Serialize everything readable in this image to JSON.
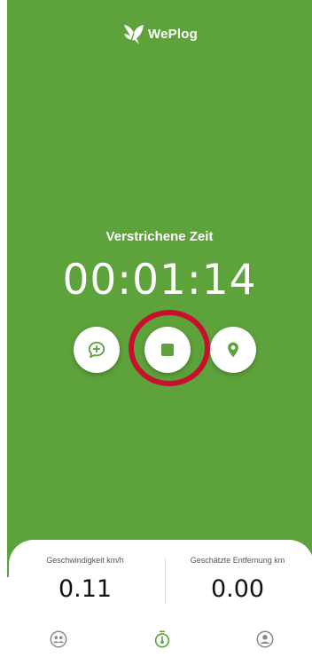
{
  "app": {
    "brand": "WePlog",
    "accent_color": "#5ea23b",
    "highlight_color": "#c8102e"
  },
  "timer": {
    "label": "Verstrichene Zeit",
    "value": "00:01:14"
  },
  "controls": {
    "left_icon": "chat-add-icon",
    "center_icon": "stop-icon",
    "right_icon": "location-pin-icon"
  },
  "stats": {
    "speed_label": "Geschwindigkeit km/h",
    "speed_value": "0.11",
    "distance_label": "Geschätzte Entfernung km",
    "distance_value": "0.00"
  },
  "nav": {
    "items": [
      "community-icon",
      "timer-icon",
      "profile-icon"
    ],
    "active": "timer-icon"
  }
}
